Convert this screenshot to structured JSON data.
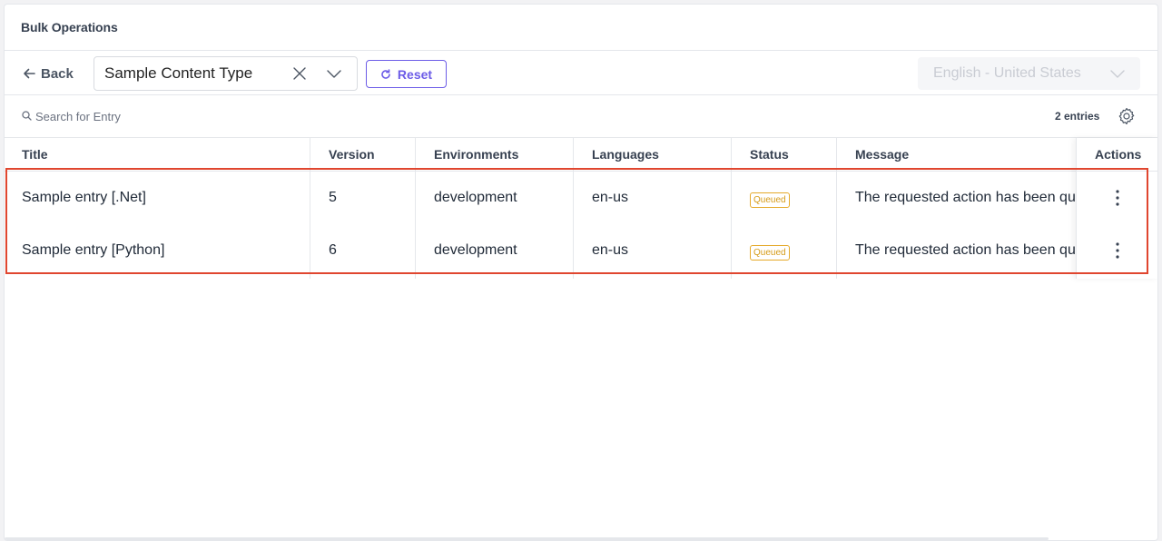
{
  "header": {
    "title": "Bulk Operations"
  },
  "toolbar": {
    "back_label": "Back",
    "content_type": "Sample Content Type",
    "reset_label": "Reset",
    "language": "English - United States"
  },
  "search": {
    "placeholder": "Search for Entry",
    "entries_count": "2 entries"
  },
  "table": {
    "columns": [
      "Title",
      "Version",
      "Environments",
      "Languages",
      "Status",
      "Message",
      "Actions"
    ],
    "rows": [
      {
        "title": "Sample entry [.Net]",
        "version": "5",
        "environments": "development",
        "languages": "en-us",
        "status": "Queued",
        "message": "The requested action has been queued"
      },
      {
        "title": "Sample entry [Python]",
        "version": "6",
        "environments": "development",
        "languages": "en-us",
        "status": "Queued",
        "message": "The requested action has been queued"
      }
    ]
  },
  "colors": {
    "accent": "#6c5ce7",
    "status_queued": "#e5a92a",
    "highlight": "#e0462f"
  },
  "icons": [
    "arrow-left-icon",
    "close-icon",
    "chevron-down-icon",
    "refresh-icon",
    "search-icon",
    "gear-icon",
    "more-vertical-icon"
  ]
}
